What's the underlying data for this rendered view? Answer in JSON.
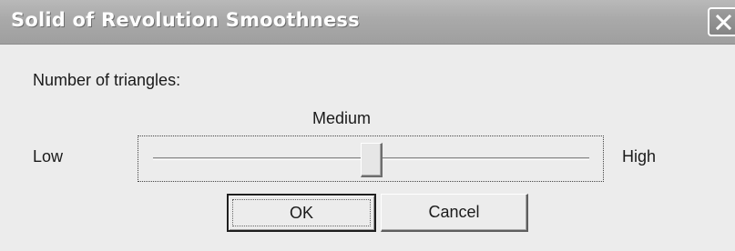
{
  "window": {
    "title": "Solid of Revolution Smoothness",
    "close_icon": "close-icon"
  },
  "dialog": {
    "prompt_label": "Number of triangles:",
    "current_level_label": "Medium",
    "low_label": "Low",
    "high_label": "High",
    "slider": {
      "value_fraction": 0.5
    }
  },
  "buttons": {
    "ok_label": "OK",
    "cancel_label": "Cancel"
  },
  "colors": {
    "titlebar": "#a9a9a9",
    "title_text": "#ffffff",
    "dialog_background": "#ececec"
  }
}
